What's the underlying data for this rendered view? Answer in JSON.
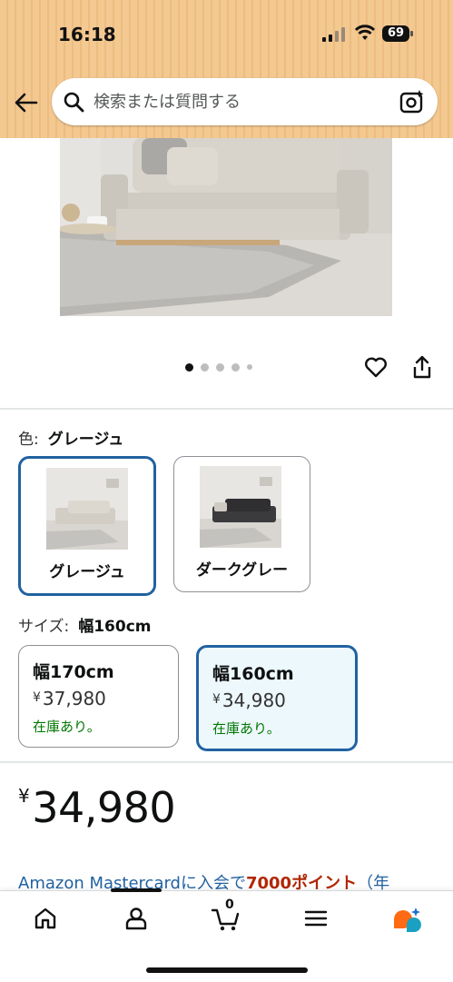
{
  "status_bar": {
    "time": "16:18",
    "battery": "69"
  },
  "search": {
    "placeholder": "検索または質問する"
  },
  "icons": {
    "back": "arrow-left-icon",
    "search": "magnifier-icon",
    "camera": "camera-sparkle-icon",
    "favorite": "heart-icon",
    "share": "share-icon",
    "nav": [
      "home-icon",
      "user-icon",
      "cart-icon",
      "menu-icon",
      "ai-assistant-icon"
    ]
  },
  "carousel": {
    "total": 5,
    "active_index": 0
  },
  "color_option": {
    "label": "色:",
    "selected": "グレージュ",
    "swatches": [
      {
        "name": "グレージュ",
        "selected": true
      },
      {
        "name": "ダークグレー",
        "selected": false
      }
    ]
  },
  "size_option": {
    "label": "サイズ:",
    "selected": "幅160cm",
    "options": [
      {
        "size": "幅170cm",
        "currency": "¥",
        "price": "37,980",
        "stock": "在庫あり。",
        "selected": false
      },
      {
        "size": "幅160cm",
        "currency": "¥",
        "price": "34,980",
        "stock": "在庫あり。",
        "selected": true
      }
    ]
  },
  "price": {
    "currency": "¥",
    "amount": "34,980"
  },
  "promo": {
    "text_1": "Amazon Mastercardに入会で",
    "points": "7000ポイント",
    "text_2": "（年"
  },
  "bottom_nav": {
    "cart_count": "0"
  },
  "colors": {
    "accent_blue": "#2162a1",
    "in_stock_green": "#007600",
    "points_red": "#b12704",
    "header_bg": "#f3c891"
  }
}
